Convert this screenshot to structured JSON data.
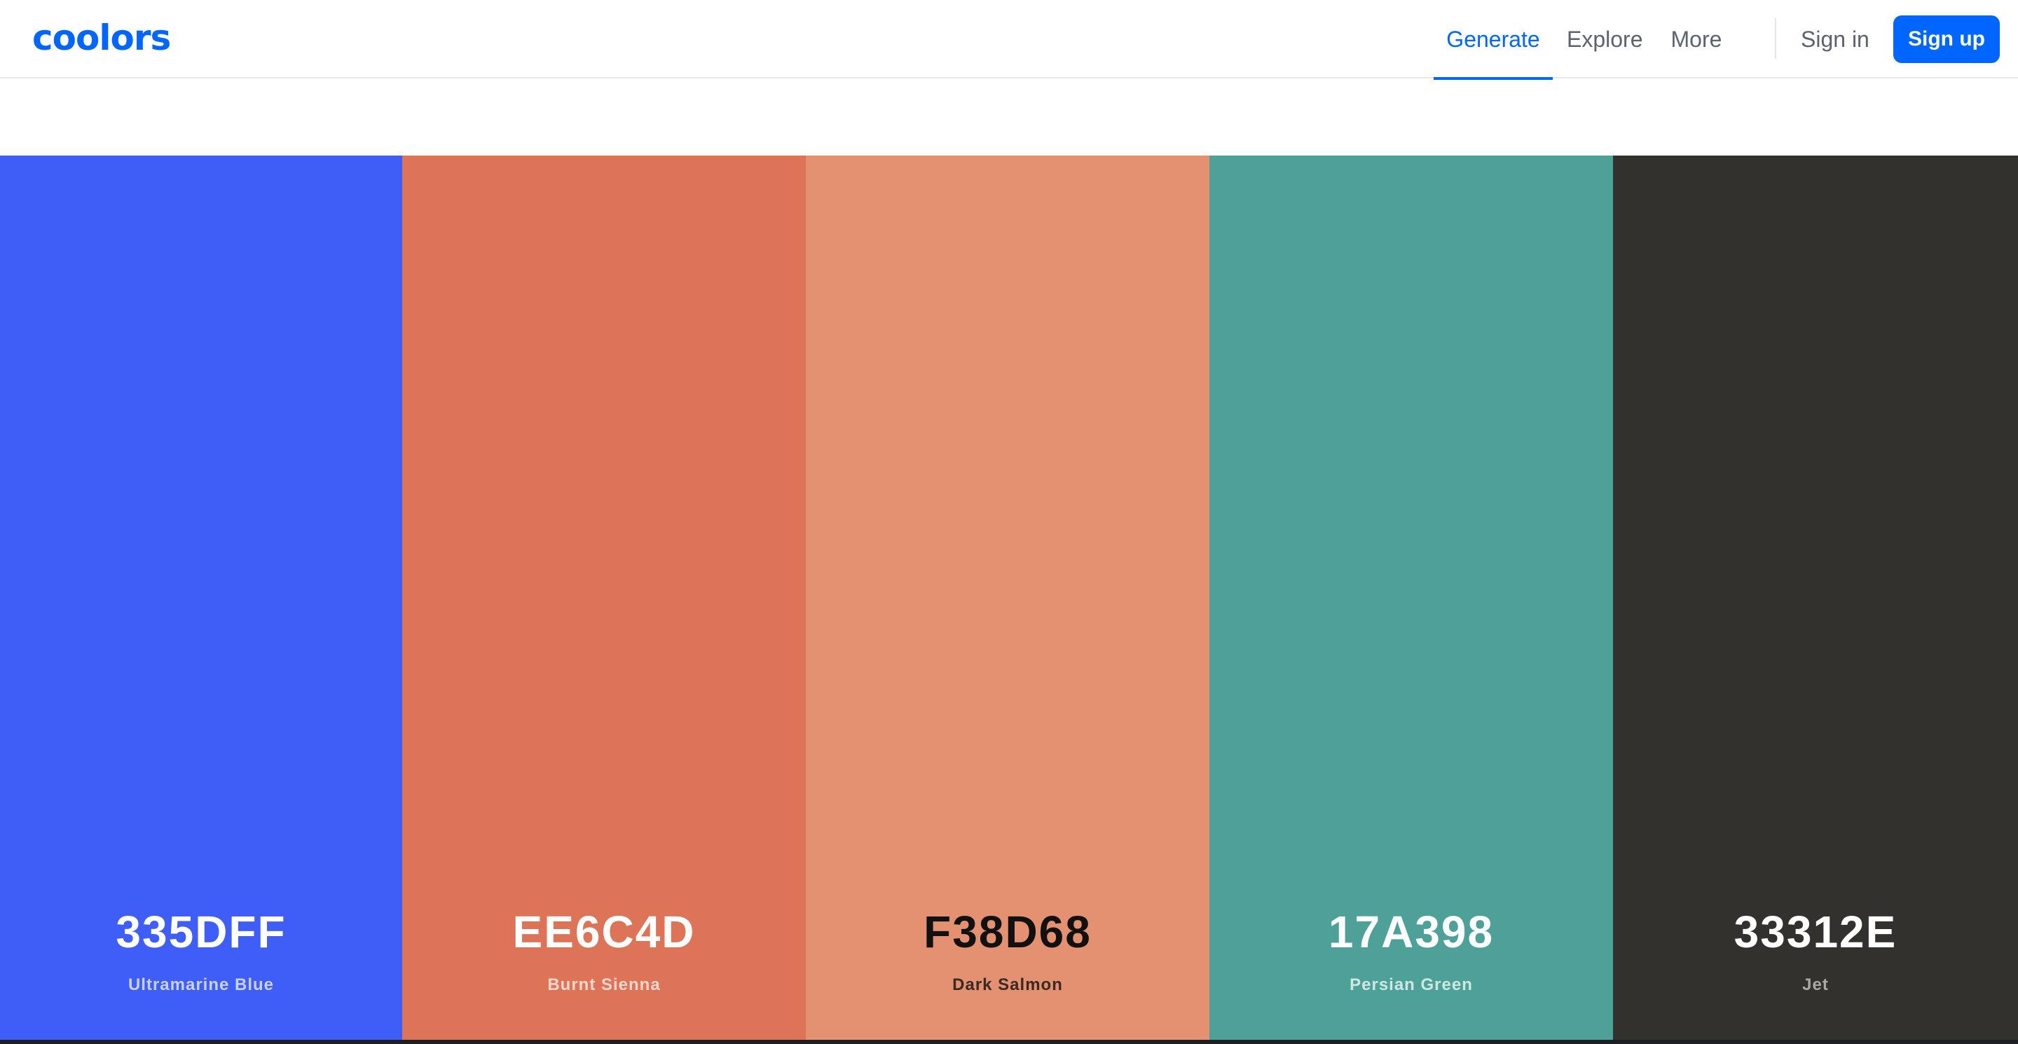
{
  "app": {
    "logo_text": "coolors"
  },
  "nav": {
    "links": [
      {
        "label": "Generate",
        "active": true
      },
      {
        "label": "Explore",
        "active": false
      },
      {
        "label": "More",
        "active": false
      }
    ],
    "sign_in": "Sign in",
    "sign_up": "Sign up"
  },
  "colors": {
    "brand": "#0066ff"
  },
  "palette": [
    {
      "hex": "335DFF",
      "name": "Ultramarine Blue",
      "display_color": "#3E5EF7",
      "hex_text_color": "#ffffff",
      "name_text_color": "#c9d2ff"
    },
    {
      "hex": "EE6C4D",
      "name": "Burnt Sienna",
      "display_color": "#DD7457",
      "hex_text_color": "#ffffff",
      "name_text_color": "#f7d6cb"
    },
    {
      "hex": "F38D68",
      "name": "Dark Salmon",
      "display_color": "#E49171",
      "hex_text_color": "#111111",
      "name_text_color": "#3a2a22"
    },
    {
      "hex": "17A398",
      "name": "Persian Green",
      "display_color": "#4DA199",
      "hex_text_color": "#ffffff",
      "name_text_color": "#cfe7e4"
    },
    {
      "hex": "33312E",
      "name": "Jet",
      "display_color": "#32312E",
      "hex_text_color": "#ffffff",
      "name_text_color": "#a9a8a5"
    }
  ]
}
